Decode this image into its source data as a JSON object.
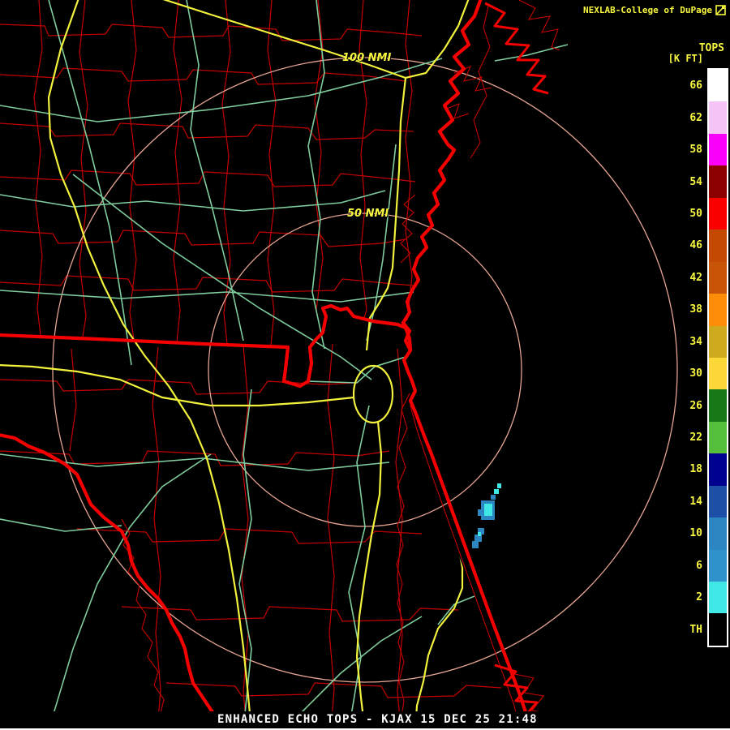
{
  "header": {
    "credit": "NEXLAB-College of DuPage",
    "logo_icon": "square-diagonal-logo"
  },
  "colorbar": {
    "title": "TOPS",
    "units": "[K FT]",
    "items": [
      {
        "label": "66",
        "color": "#FFFFFF"
      },
      {
        "label": "62",
        "color": "#F5C3F5"
      },
      {
        "label": "58",
        "color": "#FA00FA"
      },
      {
        "label": "54",
        "color": "#8C0000"
      },
      {
        "label": "50",
        "color": "#FA0000"
      },
      {
        "label": "46",
        "color": "#C44A04"
      },
      {
        "label": "42",
        "color": "#C85408"
      },
      {
        "label": "38",
        "color": "#FD8D08"
      },
      {
        "label": "34",
        "color": "#CFAA1E"
      },
      {
        "label": "30",
        "color": "#FBD838"
      },
      {
        "label": "26",
        "color": "#187818"
      },
      {
        "label": "22",
        "color": "#55BE3B"
      },
      {
        "label": "18",
        "color": "#00008E"
      },
      {
        "label": "14",
        "color": "#1D4FA6"
      },
      {
        "label": "10",
        "color": "#2C86C2"
      },
      {
        "label": "6",
        "color": "#3092CC"
      },
      {
        "label": "2",
        "color": "#3FE8E4"
      },
      {
        "label": "TH",
        "color": "#000000"
      }
    ]
  },
  "rings": {
    "outer_label": "100 NMI",
    "inner_label": "50 NMI"
  },
  "footer": {
    "status": "ENHANCED ECHO TOPS - KJAX 15 DEC 25 21:48"
  },
  "colors": {
    "bg": "#000000",
    "county-red": "#C40000",
    "border-red": "#F40000",
    "road-green": "#7FCD9E",
    "highway-yellow": "#F2F23C",
    "ring-pink": "#E6A493",
    "label-yellow": "#F8F840",
    "text-white": "#FFFFFF",
    "echo-cyan": "#3FE8E4",
    "echo-blue": "#2C86C2"
  }
}
